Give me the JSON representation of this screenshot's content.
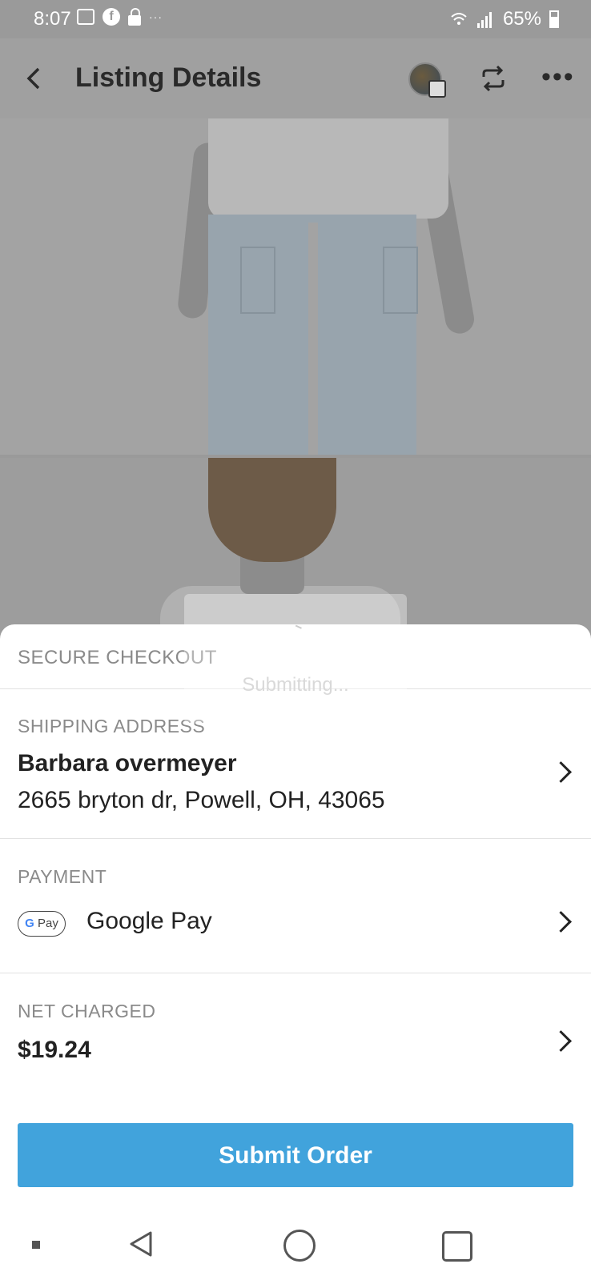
{
  "status_bar": {
    "time": "8:07",
    "overflow": "···",
    "battery": "65%",
    "icons": [
      "gallery-icon",
      "facebook-icon",
      "lock-icon",
      "wifi-icon",
      "signal-icon",
      "battery-icon"
    ]
  },
  "header": {
    "title": "Listing Details",
    "back_icon": "chevron-left-icon",
    "repost_icon": "repost-icon",
    "more_label": "•••"
  },
  "overlay": {
    "text": "Submitting..."
  },
  "checkout": {
    "title": "SECURE CHECKOUT",
    "shipping": {
      "label": "SHIPPING ADDRESS",
      "name": "Barbara overmeyer",
      "address": "2665 bryton dr, Powell, OH, 43065"
    },
    "payment": {
      "label": "PAYMENT",
      "badge_g": "G",
      "badge_text": "Pay",
      "method": "Google Pay"
    },
    "net": {
      "label": "NET CHARGED",
      "amount": "$19.24"
    },
    "submit_label": "Submit Order"
  },
  "colors": {
    "accent": "#41a3dc",
    "dim_overlay": "#9a9a9a"
  }
}
